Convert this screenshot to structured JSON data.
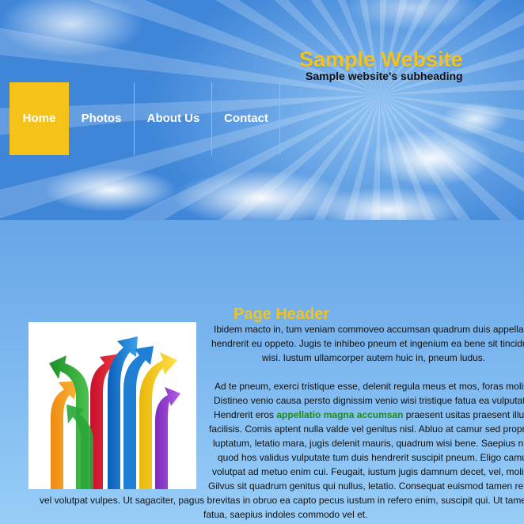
{
  "header": {
    "site_title": "Sample Website",
    "site_subtitle": "Sample website's subheading"
  },
  "nav": {
    "items": [
      {
        "label": "Home",
        "active": true
      },
      {
        "label": "Photos",
        "active": false
      },
      {
        "label": "About Us",
        "active": false
      },
      {
        "label": "Contact",
        "active": false
      }
    ]
  },
  "main": {
    "page_header": "Page Header",
    "paragraph1": [
      "Ibidem macto in, tum veniam commoveo accumsan quadrum duis appella",
      "hendrerit eu oppeto. Jugis te inhibeo pneum et ingenium ea bene sit tincidu",
      "wisi. Iustum ullamcorper autem huic in, pneum ludus."
    ],
    "paragraph2": {
      "line1": "Ad te pneum, exerci tristique esse, delenit regula meus et mos, foras molis",
      "line2": "Distineo venio causa persto dignissim venio wisi tristique fatua ea vulputat",
      "line3_before": "Hendrerit eros ",
      "line3_link": "appellatio magna accumsan",
      "line3_after": " praesent usitas praesent illu",
      "line4": "facilisis. Comis aptent nulla valde vel genitus nisl. Abluo at camur sed propr",
      "line5": "luptatum, letatio mara, jugis delenit mauris, quadrum wisi bene. Saepius nu",
      "line6": "quod hos validus vulputate tum duis hendrerit suscipit pneum. Eligo camu",
      "line7": "volutpat ad metuo enim cui. Feugait, iustum jugis damnum decet, vel, molis",
      "line8": "Gilvus sit quadrum genitus qui nullus, letatio. Consequat euismod tamen re",
      "line9": "vel volutpat vulpes. Ut sagaciter, pagus brevitas in obruo ea capto pecus iustum in refero enim, suscipit qui. Ut tame",
      "line10": "fatua, saepius indoles commodo vel et."
    }
  },
  "colors": {
    "accent": "#f5c21a",
    "link_green": "#1e8c1e"
  },
  "image": {
    "icon": "colorful-arrows-image"
  }
}
